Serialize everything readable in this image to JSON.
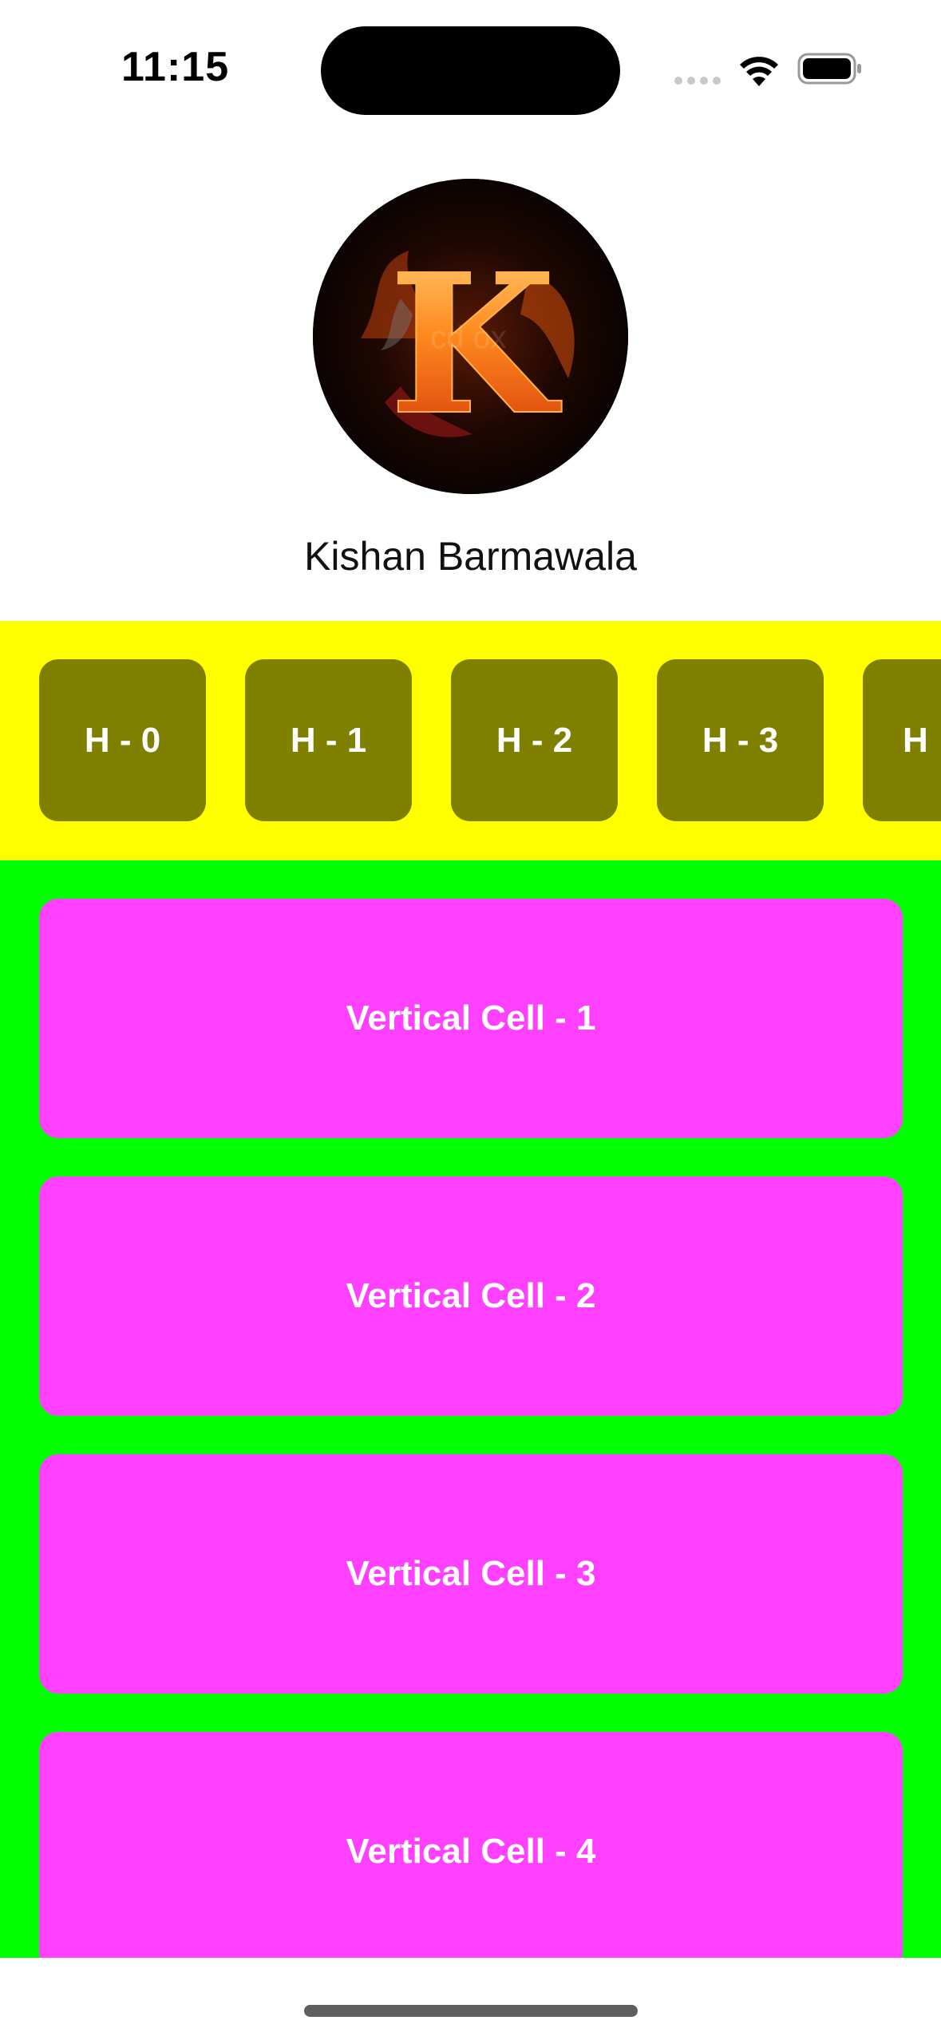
{
  "status_bar": {
    "time": "11:15"
  },
  "profile": {
    "name": "Kishan Barmawala",
    "avatar_letter": "K",
    "avatar_watermark": "cd  ox"
  },
  "horizontal_section": {
    "background_color": "#ffff00",
    "cell_color": "#808000",
    "cells": [
      {
        "label": "H - 0"
      },
      {
        "label": "H - 1"
      },
      {
        "label": "H - 2"
      },
      {
        "label": "H - 3"
      },
      {
        "label": "H"
      }
    ]
  },
  "vertical_section": {
    "background_color": "#00ff00",
    "cell_color": "#ff40ff",
    "cells": [
      {
        "label": "Vertical Cell - 1"
      },
      {
        "label": "Vertical Cell - 2"
      },
      {
        "label": "Vertical Cell - 3"
      },
      {
        "label": "Vertical Cell - 4"
      }
    ]
  },
  "icons": {
    "cell_signal": "cell-signal-icon",
    "wifi": "wifi-icon",
    "battery": "battery-icon"
  }
}
